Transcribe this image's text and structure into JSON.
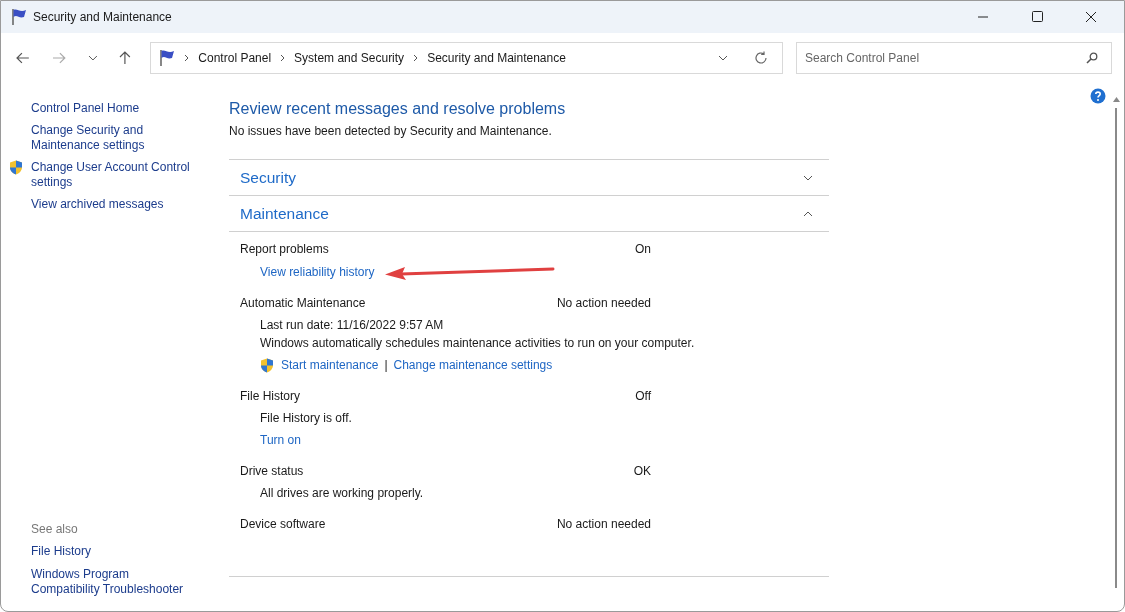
{
  "window": {
    "title": "Security and Maintenance"
  },
  "address": {
    "breadcrumbs": [
      "Control Panel",
      "System and Security",
      "Security and Maintenance"
    ]
  },
  "search": {
    "placeholder": "Search Control Panel"
  },
  "sidebar": {
    "links": [
      {
        "label": "Control Panel Home",
        "kind": "plain"
      },
      {
        "label": "Change Security and Maintenance settings",
        "kind": "plain"
      },
      {
        "label": "Change User Account Control settings",
        "kind": "shield"
      },
      {
        "label": "View archived messages",
        "kind": "plain"
      }
    ],
    "see_also_heading": "See also",
    "see_also": [
      "File History",
      "Windows Program Compatibility Troubleshooter"
    ]
  },
  "main": {
    "heading": "Review recent messages and resolve problems",
    "subtitle": "No issues have been detected by Security and Maintenance.",
    "sections": [
      {
        "title": "Security",
        "expanded": false
      },
      {
        "title": "Maintenance",
        "expanded": true
      }
    ],
    "items": [
      {
        "label": "Report problems",
        "status": "On",
        "details": [
          {
            "kind": "link",
            "text": "View reliability history",
            "annotated": true
          }
        ]
      },
      {
        "label": "Automatic Maintenance",
        "status": "No action needed",
        "details": [
          {
            "kind": "text",
            "text": "Last run date: 11/16/2022 9:57 AM"
          },
          {
            "kind": "text",
            "text": "Windows automatically schedules maintenance activities to run on your computer."
          },
          {
            "kind": "links",
            "links": [
              "Start maintenance",
              "Change maintenance settings"
            ],
            "separator": "|"
          }
        ]
      },
      {
        "label": "File History",
        "status": "Off",
        "details": [
          {
            "kind": "text",
            "text": "File History is off."
          },
          {
            "kind": "link",
            "text": "Turn on",
            "annotated": false
          }
        ]
      },
      {
        "label": "Drive status",
        "status": "OK",
        "details": [
          {
            "kind": "text",
            "text": "All drives are working properly."
          }
        ]
      },
      {
        "label": "Device software",
        "status": "No action needed"
      }
    ]
  }
}
